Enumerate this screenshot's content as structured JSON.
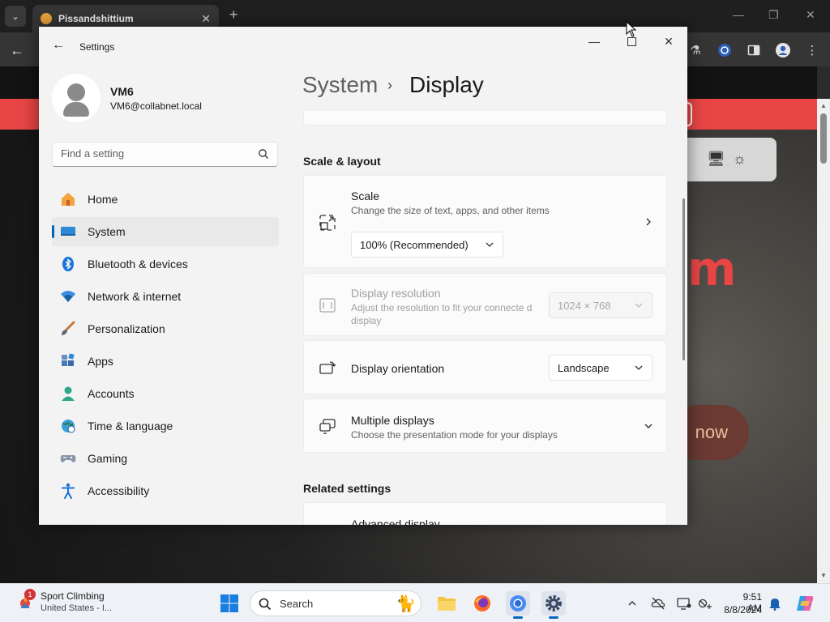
{
  "browser": {
    "tab_title": "Pissandshittium",
    "page_banner_text": "m",
    "page_button_text": "now"
  },
  "settings": {
    "window_title": "Settings",
    "user": {
      "name": "VM6",
      "email": "VM6@collabnet.local"
    },
    "search_placeholder": "Find a setting",
    "nav": [
      {
        "label": "Home",
        "icon": "home-icon",
        "active": false
      },
      {
        "label": "System",
        "icon": "system-icon",
        "active": true
      },
      {
        "label": "Bluetooth & devices",
        "icon": "bluetooth-icon",
        "active": false
      },
      {
        "label": "Network & internet",
        "icon": "wifi-icon",
        "active": false
      },
      {
        "label": "Personalization",
        "icon": "brush-icon",
        "active": false
      },
      {
        "label": "Apps",
        "icon": "apps-icon",
        "active": false
      },
      {
        "label": "Accounts",
        "icon": "accounts-icon",
        "active": false
      },
      {
        "label": "Time & language",
        "icon": "globe-clock-icon",
        "active": false
      },
      {
        "label": "Gaming",
        "icon": "gamepad-icon",
        "active": false
      },
      {
        "label": "Accessibility",
        "icon": "accessibility-icon",
        "active": false
      }
    ],
    "breadcrumb": {
      "parent": "System",
      "separator": "›",
      "current": "Display"
    },
    "scale_layout": {
      "title": "Scale & layout",
      "scale": {
        "title": "Scale",
        "desc": "Change the size of text, apps, and other items",
        "value": "100% (Recommended)"
      },
      "resolution": {
        "title": "Display resolution",
        "desc": "Adjust the resolution to fit your connecte d display",
        "value": "1024 × 768"
      },
      "orientation": {
        "title": "Display orientation",
        "value": "Landscape"
      },
      "multiple": {
        "title": "Multiple displays",
        "desc": "Choose the presentation mode for your displays"
      }
    },
    "related": {
      "title": "Related settings",
      "advanced": "Advanced display"
    }
  },
  "taskbar": {
    "weather_title": "Sport Climbing",
    "weather_sub": "United States - I...",
    "weather_badge": "1",
    "search_text": "Search",
    "time": "9:51 AM",
    "date": "8/8/2024"
  }
}
